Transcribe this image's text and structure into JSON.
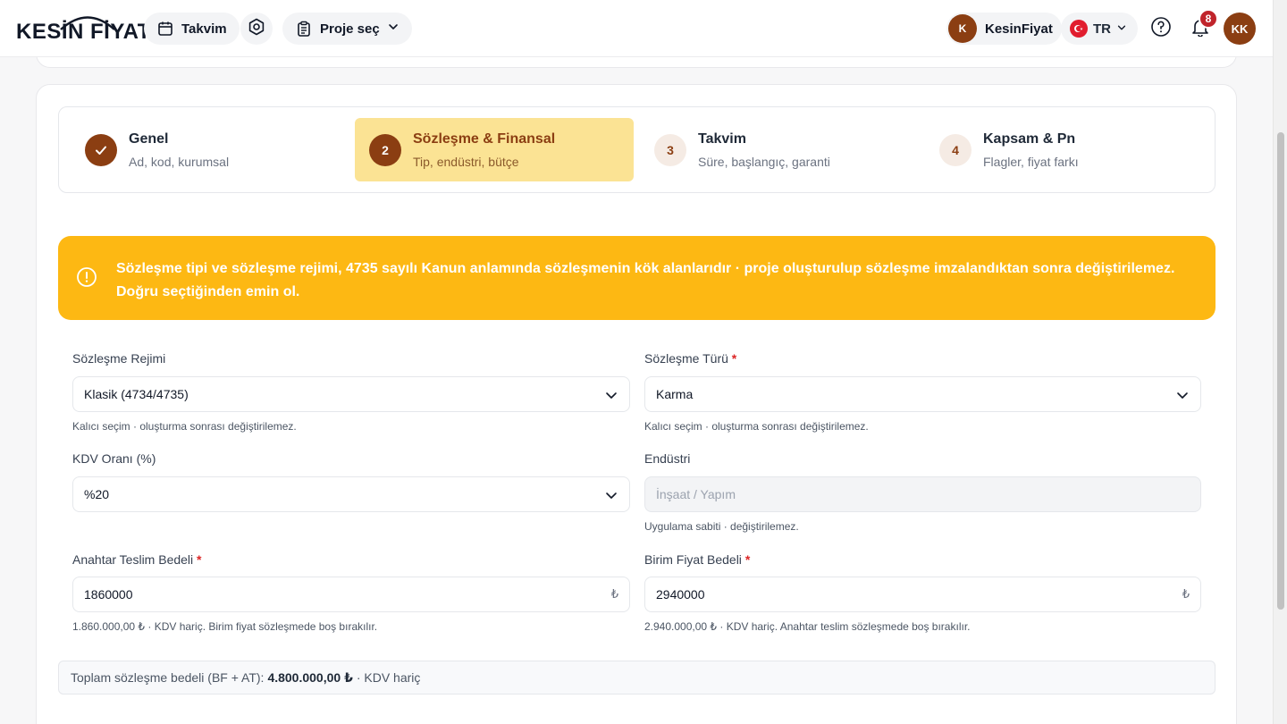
{
  "header": {
    "logo_text": "KESİN FİYAT",
    "calendar_label": "Takvim",
    "project_select_label": "Proje seç",
    "user_initial": "K",
    "user_name": "KesinFiyat",
    "language": "TR",
    "notification_count": "8",
    "profile_initials": "KK",
    "icons": [
      "calendar-icon",
      "settings-icon",
      "clipboard-icon",
      "chevron-down-icon",
      "flag-tr-icon",
      "help-icon",
      "bell-icon"
    ]
  },
  "stepper": {
    "steps": [
      {
        "num": "1",
        "title": "Genel",
        "subtitle": "Ad, kod, kurumsal",
        "state": "done"
      },
      {
        "num": "2",
        "title": "Sözleşme & Finansal",
        "subtitle": "Tip, endüstri, bütçe",
        "state": "active"
      },
      {
        "num": "3",
        "title": "Takvim",
        "subtitle": "Süre, başlangıç, garanti",
        "state": "todo"
      },
      {
        "num": "4",
        "title": "Kapsam & Pn",
        "subtitle": "Flagler, fiyat farkı",
        "state": "todo"
      }
    ]
  },
  "alert": {
    "text": "Sözleşme tipi ve sözleşme rejimi, 4735 sayılı Kanun anlamında sözleşmenin kök alanlarıdır · proje oluşturulup sözleşme imzalandıktan sonra değiştirilemez. Doğru seçtiğinden emin ol.",
    "color": "#fdb813"
  },
  "form": {
    "regime": {
      "label": "Sözleşme Rejimi",
      "value": "Klasik (4734/4735)",
      "hint": "Kalıcı seçim · oluşturma sonrası değiştirilemez."
    },
    "type": {
      "label": "Sözleşme Türü",
      "required": "*",
      "value": "Karma",
      "hint": "Kalıcı seçim · oluşturma sonrası değiştirilemez."
    },
    "vat": {
      "label": "KDV Oranı (%)",
      "value": "%20"
    },
    "industry": {
      "label": "Endüstri",
      "placeholder": "İnşaat / Yapım",
      "hint": "Uygulama sabiti · değiştirilemez."
    },
    "turnkey": {
      "label": "Anahtar Teslim Bedeli",
      "required": "*",
      "value": "1860000",
      "currency": "₺",
      "hint": "1.860.000,00 ₺ · KDV hariç. Birim fiyat sözleşmede boş bırakılır."
    },
    "unit_price": {
      "label": "Birim Fiyat Bedeli",
      "required": "*",
      "value": "2940000",
      "currency": "₺",
      "hint": "2.940.000,00 ₺ · KDV hariç. Anahtar teslim sözleşmede boş bırakılır."
    }
  },
  "total": {
    "label": "Toplam sözleşme bedeli (BF + AT):",
    "value": "4.800.000,00 ₺",
    "suffix": "· KDV hariç"
  },
  "colors": {
    "brand": "#8b3e12",
    "active_step_bg": "#fbe394",
    "alert": "#fdb813",
    "badge": "#c0242b"
  }
}
